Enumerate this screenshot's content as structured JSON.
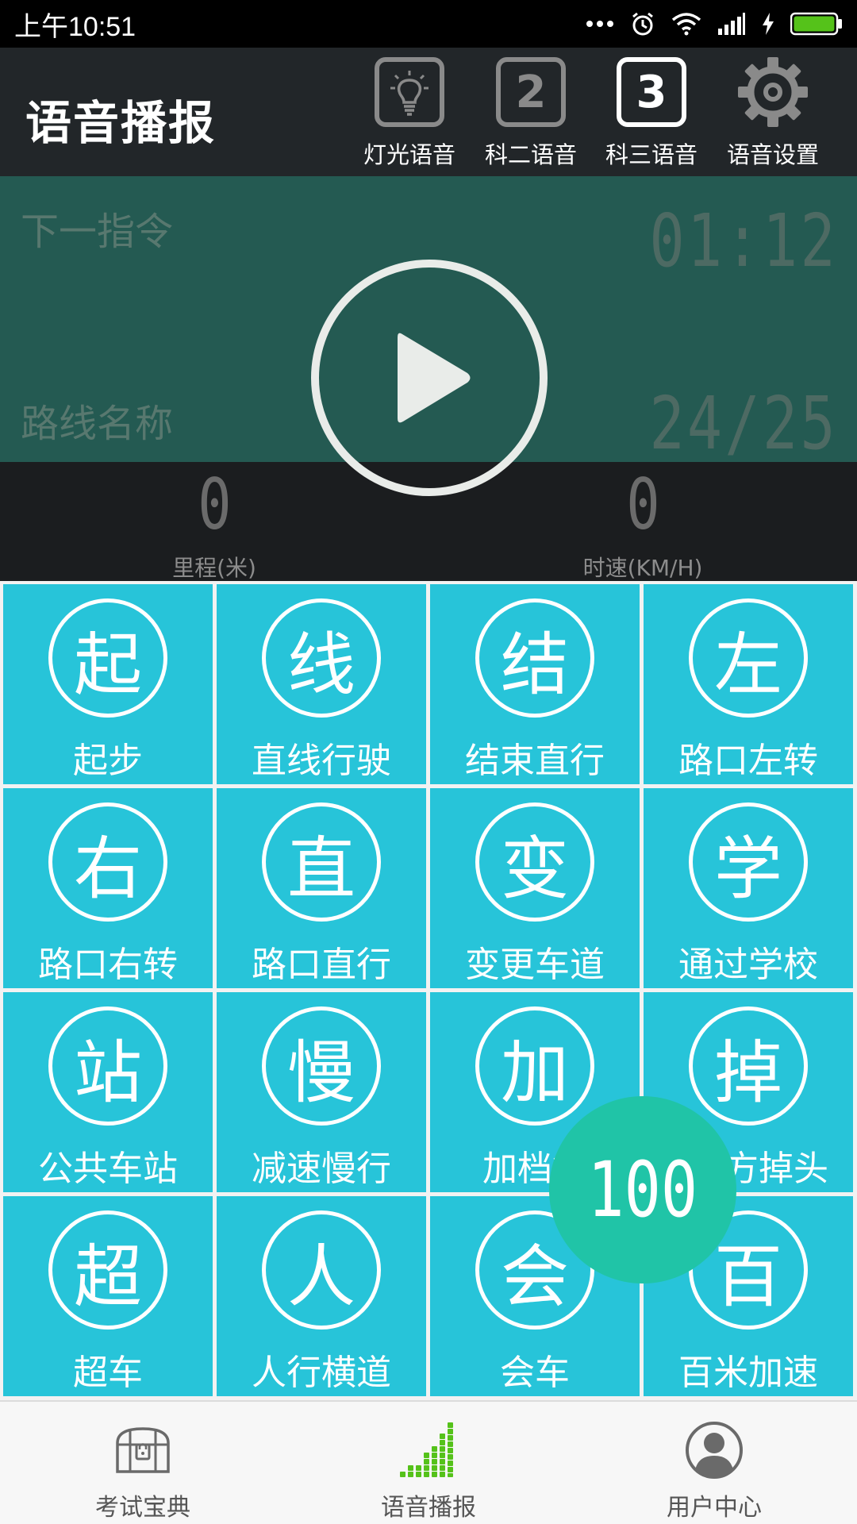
{
  "status_bar": {
    "time": "上午10:51"
  },
  "header": {
    "title": "语音播报",
    "tabs": [
      {
        "label": "灯光语音",
        "icon": "light-bulb-icon"
      },
      {
        "label": "科二语音",
        "icon_text": "2"
      },
      {
        "label": "科三语音",
        "icon_text": "3",
        "active": true
      },
      {
        "label": "语音设置",
        "icon": "gear-icon"
      }
    ]
  },
  "display": {
    "next_command_label": "下一指令",
    "route_name_label": "路线名称",
    "time": "01:12",
    "route_progress": "24/25"
  },
  "readout": {
    "distance": {
      "value": "0",
      "label": "里程(米)"
    },
    "speed": {
      "value": "0",
      "label": "时速(KM/H)"
    }
  },
  "grid": {
    "items": [
      {
        "glyph": "起",
        "label": "起步"
      },
      {
        "glyph": "线",
        "label": "直线行驶"
      },
      {
        "glyph": "结",
        "label": "结束直行"
      },
      {
        "glyph": "左",
        "label": "路口左转"
      },
      {
        "glyph": "右",
        "label": "路口右转"
      },
      {
        "glyph": "直",
        "label": "路口直行"
      },
      {
        "glyph": "变",
        "label": "变更车道"
      },
      {
        "glyph": "学",
        "label": "通过学校"
      },
      {
        "glyph": "站",
        "label": "公共车站"
      },
      {
        "glyph": "慢",
        "label": "减速慢行"
      },
      {
        "glyph": "加",
        "label": "加档行"
      },
      {
        "glyph": "掉",
        "label": "方掉头"
      },
      {
        "glyph": "超",
        "label": "超车"
      },
      {
        "glyph": "人",
        "label": "人行横道"
      },
      {
        "glyph": "会",
        "label": "会车"
      },
      {
        "glyph": "百",
        "label": "百米加速"
      }
    ]
  },
  "floating_speed": "100",
  "bottom_nav": {
    "items": [
      {
        "label": "考试宝典",
        "icon": "treasure-chest-icon"
      },
      {
        "label": "语音播报",
        "icon": "signal-bars-icon",
        "active": true
      },
      {
        "label": "用户中心",
        "icon": "user-avatar-icon"
      }
    ]
  },
  "colors": {
    "header_bg": "#222629",
    "display_bg": "#245a52",
    "tile_bg": "#27c4d9",
    "float_bg": "#20c4a7",
    "accent_green": "#55c21a"
  }
}
